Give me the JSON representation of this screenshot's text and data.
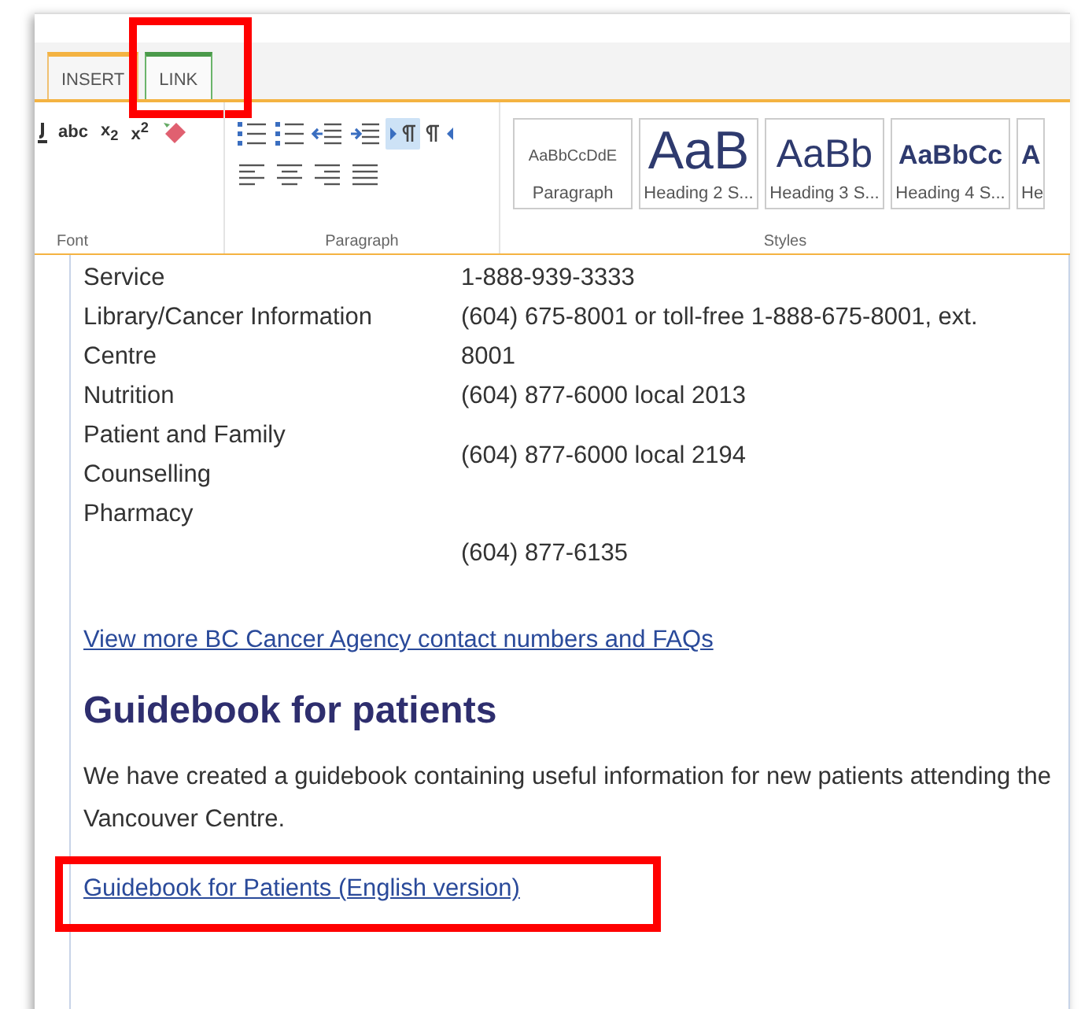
{
  "tabs": [
    {
      "label": "INSERT",
      "selected": false
    },
    {
      "label": "LINK",
      "selected": true
    }
  ],
  "ribbon": {
    "font_group": {
      "label": "Font",
      "buttons": [
        {
          "kind": "underline"
        },
        {
          "kind": "text",
          "text": "abc"
        },
        {
          "kind": "text",
          "text": "x$_{2}$"
        },
        {
          "kind": "text",
          "text": "x$^{2}$"
        },
        {
          "kind": "eraser"
        }
      ]
    },
    "paragraph_group": {
      "label": "Paragraph",
      "rows": [
        [
          {
            "kind": "bullets",
            "selected": false
          },
          {
            "kind": "numbering",
            "selected": false
          },
          {
            "kind": "outdent",
            "selected": false
          },
          {
            "kind": "indent",
            "selected": false
          },
          {
            "kind": "ltr",
            "selected": true
          },
          {
            "kind": "rtl",
            "selected": false
          }
        ],
        [
          {
            "kind": "align-left",
            "selected": false
          },
          {
            "kind": "align-center",
            "selected": false
          },
          {
            "kind": "align-right",
            "selected": false
          },
          {
            "kind": "justify",
            "selected": false
          }
        ]
      ]
    },
    "styles_group": {
      "label": "Styles",
      "styles": [
        {
          "kind": "paragraph",
          "preview": "AaBbCcDdE",
          "label": "Paragraph"
        },
        {
          "kind": "h2",
          "preview": "AaB",
          "label": "Heading 2 S..."
        },
        {
          "kind": "h3",
          "preview": "AaBb",
          "label": "Heading 3 S..."
        },
        {
          "kind": "h4",
          "preview": "AaBbCc",
          "label": "Heading 4 S..."
        },
        {
          "kind": "h5",
          "preview": "A",
          "label": "He"
        }
      ]
    }
  },
  "contacts": [
    {
      "name": "Service",
      "phone": "1-888-939-3333"
    },
    {
      "name": "Library/Cancer Information Centre",
      "phone": "(604) 675-8001 or toll-free 1-888-675-8001, ext. 8001"
    },
    {
      "name": "Nutrition",
      "phone": "(604) 877-6000 local 2013"
    },
    {
      "name": "Patient and Family Counselling",
      "phone": "(604) 877-6000 local 2194"
    },
    {
      "name": "Pharmacy",
      "phone": "(604) 877-6135"
    }
  ],
  "more_link": "View more BC Cancer Agency contact numbers and FAQs",
  "heading": "Guidebook for patients",
  "paragraph": "We have created a guidebook containing useful information for new patients attending the Vancouver Centre.",
  "guide_link": {
    "text": "Guidebook for Patients (English version)",
    "highlighted": true
  },
  "tab_highlighted": true
}
